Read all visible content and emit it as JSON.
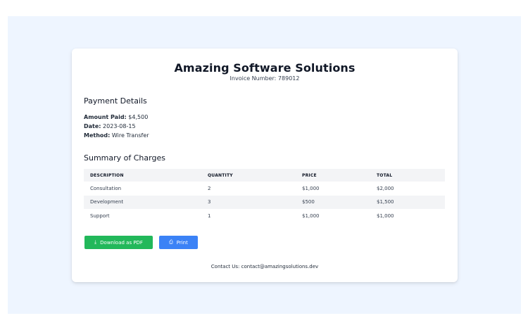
{
  "header": {
    "company_name": "Amazing Software Solutions",
    "invoice_label": "Invoice Number:",
    "invoice_number": "789012"
  },
  "payment_details": {
    "heading": "Payment Details",
    "amount_label": "Amount Paid:",
    "amount_value": "$4,500",
    "date_label": "Date:",
    "date_value": "2023-08-15",
    "method_label": "Method:",
    "method_value": "Wire Transfer"
  },
  "summary": {
    "heading": "Summary of Charges",
    "columns": [
      "DESCRIPTION",
      "QUANTITY",
      "PRICE",
      "TOTAL"
    ],
    "rows": [
      [
        "Consultation",
        "2",
        "$1,000",
        "$2,000"
      ],
      [
        "Development",
        "3",
        "$500",
        "$1,500"
      ],
      [
        "Support",
        "1",
        "$1,000",
        "$1,000"
      ]
    ]
  },
  "actions": {
    "download_label": "Download as PDF",
    "download_icon": "download-icon",
    "print_label": "Print",
    "print_icon": "print-icon",
    "download_color": "#22b85a",
    "print_color": "#3b82f6"
  },
  "footer": {
    "contact_label": "Contact Us:",
    "contact_email": "contact@amazingsolutions.dev"
  }
}
